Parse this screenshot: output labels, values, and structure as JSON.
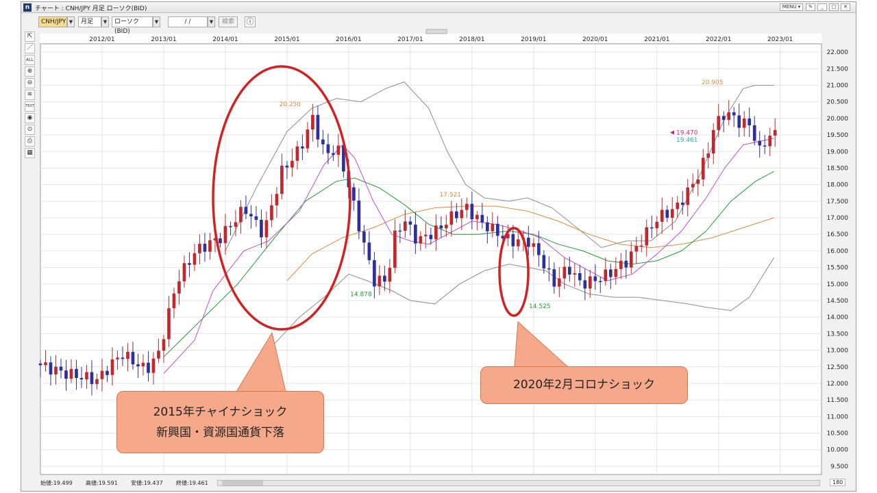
{
  "window": {
    "title": "チャート : CNH/JPY 月足 ローソク(BID)",
    "menu_label": "MENU ▾",
    "controls": [
      "✎",
      "_",
      "□",
      "✕"
    ]
  },
  "toolbar": {
    "symbol": "CNH/JPY",
    "period": "月足",
    "chart_type": "ローソク(BID)",
    "date_value": "/ /",
    "search_label": "検索",
    "info_icon": "ⓘ",
    "dropdown_glyph": "▼"
  },
  "left_tools": [
    "⇱",
    "／",
    "ALL",
    "⊕",
    "⊖",
    "≋",
    "TEXT",
    "◉",
    "⊙",
    "⎙",
    "▦"
  ],
  "status": {
    "open": "始値:19.499",
    "high": "高値:19.591",
    "low": "安値:19.437",
    "close": "終値:19.461",
    "bars": "180"
  },
  "callouts": [
    {
      "text_line1": "2015年チャイナショック",
      "text_line2": "新興国・資源国通貨下落"
    },
    {
      "text_line1": "2020年2月コロナショック",
      "text_line2": ""
    }
  ],
  "colors": {
    "up": "#c0282d",
    "down": "#2c2f9c",
    "ma_short": "#c04fc8",
    "ma_mid": "#1f9a3a",
    "ma_long": "#e08a3c",
    "bollinger": "#8c8c8c",
    "circle": "#d42020",
    "last_bid": "#d0207a",
    "last_close": "#1fb0c0"
  },
  "chart_data": {
    "type": "candlestick",
    "title": "",
    "x_tick_labels": [
      "2012/01",
      "2013/01",
      "2014/01",
      "2015/01",
      "2016/01",
      "2017/01",
      "2018/01",
      "2019/01",
      "2020/01",
      "2021/01",
      "2022/01",
      "2023/01"
    ],
    "y_tick_labels": [
      "22.000",
      "21.500",
      "21.000",
      "20.500",
      "20.000",
      "19.500",
      "19.000",
      "18.500",
      "18.000",
      "17.500",
      "17.000",
      "16.500",
      "16.000",
      "15.500",
      "15.000",
      "14.500",
      "14.000",
      "13.500",
      "13.000",
      "12.500",
      "12.000",
      "11.500",
      "11.000",
      "10.500",
      "10.000",
      "9.500"
    ],
    "ylim": [
      9.25,
      22.25
    ],
    "grid": true,
    "annotations": [
      {
        "text": "20.250",
        "x": 2015.05,
        "y": 20.25,
        "color": "#e08a3c"
      },
      {
        "text": "14.878",
        "x": 2016.2,
        "y": 14.878,
        "color": "#1f9a3a"
      },
      {
        "text": "17.521",
        "x": 2017.65,
        "y": 17.521,
        "color": "#e08a3c"
      },
      {
        "text": "14.525",
        "x": 2019.1,
        "y": 14.525,
        "color": "#1f9a3a"
      },
      {
        "text": "20.905",
        "x": 2021.9,
        "y": 20.905,
        "color": "#e08a3c"
      }
    ],
    "last_values": [
      {
        "text": "19.470",
        "y": 19.47,
        "color": "#d0207a"
      },
      {
        "text": "19.461",
        "y": 19.461,
        "color": "#1fb0c0"
      }
    ],
    "anchors": [
      [
        2011.0,
        12.6
      ],
      [
        2011.5,
        12.3
      ],
      [
        2012.0,
        12.1
      ],
      [
        2012.4,
        12.9
      ],
      [
        2012.8,
        12.4
      ],
      [
        2013.0,
        12.9
      ],
      [
        2013.3,
        15.1
      ],
      [
        2013.6,
        16.0
      ],
      [
        2014.0,
        16.4
      ],
      [
        2014.4,
        17.3
      ],
      [
        2014.7,
        16.5
      ],
      [
        2015.0,
        18.4
      ],
      [
        2015.3,
        19.1
      ],
      [
        2015.5,
        20.0
      ],
      [
        2015.7,
        18.9
      ],
      [
        2015.9,
        19.1
      ],
      [
        2016.05,
        18.2
      ],
      [
        2016.3,
        16.4
      ],
      [
        2016.5,
        15.1
      ],
      [
        2016.7,
        15.1
      ],
      [
        2016.85,
        16.6
      ],
      [
        2017.0,
        16.9
      ],
      [
        2017.2,
        16.3
      ],
      [
        2017.5,
        16.6
      ],
      [
        2017.8,
        17.1
      ],
      [
        2018.0,
        17.3
      ],
      [
        2018.2,
        16.9
      ],
      [
        2018.45,
        16.6
      ],
      [
        2018.7,
        16.3
      ],
      [
        2019.0,
        16.3
      ],
      [
        2019.2,
        15.8
      ],
      [
        2019.4,
        15.0
      ],
      [
        2019.65,
        15.5
      ],
      [
        2019.85,
        15.0
      ],
      [
        2020.05,
        15.1
      ],
      [
        2020.3,
        15.3
      ],
      [
        2020.6,
        15.7
      ],
      [
        2020.9,
        16.5
      ],
      [
        2021.1,
        17.0
      ],
      [
        2021.4,
        17.3
      ],
      [
        2021.7,
        18.1
      ],
      [
        2021.9,
        18.9
      ],
      [
        2022.0,
        19.7
      ],
      [
        2022.2,
        20.2
      ],
      [
        2022.4,
        19.9
      ],
      [
        2022.6,
        19.8
      ],
      [
        2022.75,
        19.0
      ],
      [
        2022.9,
        19.5
      ]
    ],
    "ma_short": [
      [
        2013.0,
        12.3
      ],
      [
        2013.5,
        13.3
      ],
      [
        2013.8,
        14.8
      ],
      [
        2014.3,
        16.0
      ],
      [
        2014.7,
        16.3
      ],
      [
        2015.2,
        17.2
      ],
      [
        2015.6,
        18.6
      ],
      [
        2015.9,
        19.2
      ],
      [
        2016.1,
        18.8
      ],
      [
        2016.4,
        17.5
      ],
      [
        2016.7,
        16.5
      ],
      [
        2017.0,
        16.3
      ],
      [
        2017.3,
        16.2
      ],
      [
        2017.7,
        16.6
      ],
      [
        2018.0,
        16.9
      ],
      [
        2018.4,
        16.8
      ],
      [
        2018.8,
        16.6
      ],
      [
        2019.1,
        16.4
      ],
      [
        2019.5,
        15.8
      ],
      [
        2019.9,
        15.4
      ],
      [
        2020.2,
        15.1
      ],
      [
        2020.6,
        15.3
      ],
      [
        2021.0,
        15.9
      ],
      [
        2021.4,
        16.6
      ],
      [
        2021.8,
        17.6
      ],
      [
        2022.1,
        18.5
      ],
      [
        2022.4,
        19.2
      ],
      [
        2022.9,
        19.4
      ]
    ],
    "ma_mid": [
      [
        2013.0,
        12.8
      ],
      [
        2013.6,
        13.9
      ],
      [
        2014.2,
        15.0
      ],
      [
        2014.8,
        16.4
      ],
      [
        2015.3,
        17.5
      ],
      [
        2015.8,
        18.1
      ],
      [
        2016.1,
        18.2
      ],
      [
        2016.5,
        17.9
      ],
      [
        2016.9,
        17.4
      ],
      [
        2017.3,
        16.8
      ],
      [
        2017.7,
        16.5
      ],
      [
        2018.1,
        16.5
      ],
      [
        2018.6,
        16.6
      ],
      [
        2019.0,
        16.5
      ],
      [
        2019.4,
        16.2
      ],
      [
        2019.8,
        16.0
      ],
      [
        2020.2,
        15.7
      ],
      [
        2020.6,
        15.6
      ],
      [
        2021.0,
        15.7
      ],
      [
        2021.4,
        16.0
      ],
      [
        2021.8,
        16.6
      ],
      [
        2022.2,
        17.5
      ],
      [
        2022.6,
        18.1
      ],
      [
        2022.9,
        18.4
      ]
    ],
    "ma_long": [
      [
        2015.0,
        15.1
      ],
      [
        2015.4,
        15.9
      ],
      [
        2015.9,
        16.4
      ],
      [
        2016.4,
        16.7
      ],
      [
        2016.9,
        17.1
      ],
      [
        2017.4,
        17.3
      ],
      [
        2017.9,
        17.35
      ],
      [
        2018.4,
        17.35
      ],
      [
        2018.9,
        17.2
      ],
      [
        2019.4,
        16.9
      ],
      [
        2019.9,
        16.5
      ],
      [
        2020.4,
        16.2
      ],
      [
        2020.9,
        16.1
      ],
      [
        2021.4,
        16.2
      ],
      [
        2021.9,
        16.4
      ],
      [
        2022.4,
        16.7
      ],
      [
        2022.9,
        17.0
      ]
    ],
    "boll_upper": [
      [
        2014.0,
        16.0
      ],
      [
        2014.5,
        17.9
      ],
      [
        2015.0,
        19.6
      ],
      [
        2015.4,
        20.3
      ],
      [
        2015.8,
        20.6
      ],
      [
        2016.2,
        20.5
      ],
      [
        2016.6,
        20.9
      ],
      [
        2016.9,
        21.1
      ],
      [
        2017.3,
        20.3
      ],
      [
        2017.6,
        19.0
      ],
      [
        2017.9,
        18.0
      ],
      [
        2018.2,
        17.6
      ],
      [
        2018.6,
        17.5
      ],
      [
        2018.9,
        17.6
      ],
      [
        2019.3,
        17.3
      ],
      [
        2019.7,
        16.7
      ],
      [
        2020.1,
        16.1
      ],
      [
        2020.5,
        16.3
      ],
      [
        2020.9,
        16.3
      ],
      [
        2021.3,
        16.9
      ],
      [
        2021.7,
        18.3
      ],
      [
        2022.1,
        20.0
      ],
      [
        2022.4,
        20.9
      ],
      [
        2022.6,
        21.0
      ],
      [
        2022.9,
        21.0
      ]
    ],
    "boll_lower": [
      [
        2014.3,
        11.5
      ],
      [
        2014.8,
        13.2
      ],
      [
        2015.2,
        14.0
      ],
      [
        2015.6,
        14.6
      ],
      [
        2016.0,
        15.3
      ],
      [
        2016.3,
        15.1
      ],
      [
        2016.7,
        14.8
      ],
      [
        2017.0,
        14.5
      ],
      [
        2017.4,
        14.4
      ],
      [
        2017.8,
        15.0
      ],
      [
        2018.2,
        15.4
      ],
      [
        2018.6,
        15.6
      ],
      [
        2018.9,
        15.5
      ],
      [
        2019.2,
        15.4
      ],
      [
        2019.5,
        15.0
      ],
      [
        2019.9,
        14.7
      ],
      [
        2020.3,
        14.6
      ],
      [
        2020.7,
        14.6
      ],
      [
        2021.1,
        14.5
      ],
      [
        2021.5,
        14.4
      ],
      [
        2021.8,
        14.3
      ],
      [
        2022.2,
        14.2
      ],
      [
        2022.5,
        14.6
      ],
      [
        2022.9,
        15.8
      ]
    ]
  }
}
